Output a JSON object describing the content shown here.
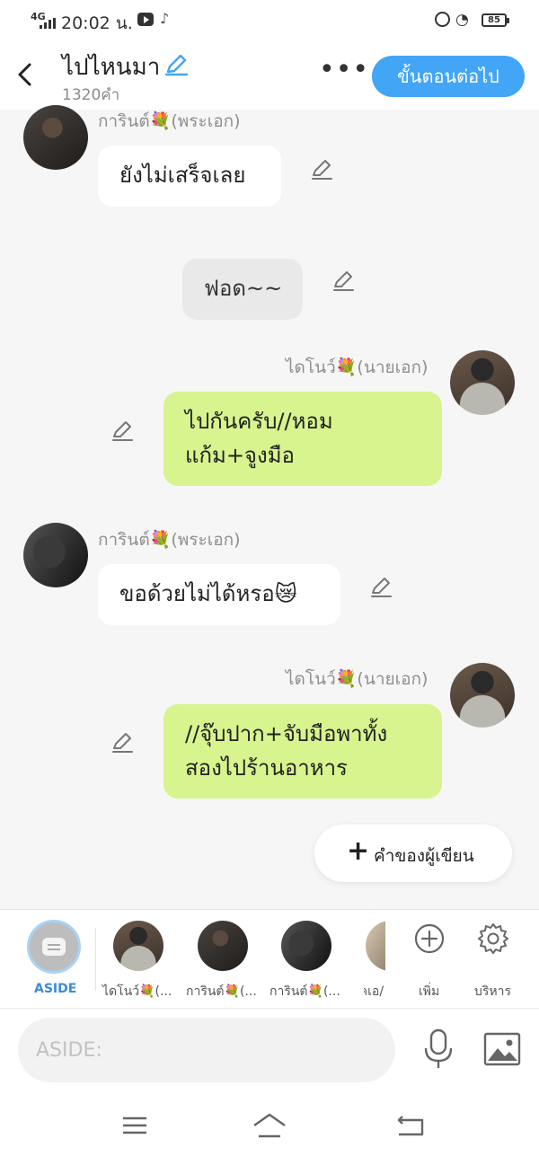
{
  "status_bar": {
    "network": "4G",
    "time": "20:02 น.",
    "battery": "85"
  },
  "header": {
    "title": "ไปไหนมา",
    "word_count": "1320คำ",
    "next_button": "ขั้นตอนต่อไป"
  },
  "messages": [
    {
      "speaker": "การินต์💐(พระเอก)",
      "text": "ยังไม่เสร็จเลย",
      "side": "left"
    },
    {
      "speaker": "",
      "text": "ฟอด~~",
      "side": "center"
    },
    {
      "speaker": "ไดโนว์💐(นายเอก)",
      "text_lines": [
        "ไปกันครับ//หอม",
        "แก้ม+จูงมือ"
      ],
      "side": "right"
    },
    {
      "speaker": "การินต์💐(พระเอก)",
      "text": "ขอด้วยไม่ได้หรอ😿",
      "side": "left"
    },
    {
      "speaker": "ไดโนว์💐(นายเอก)",
      "text_lines": [
        "//จุ๊บปาก+จับมือพาทั้ง",
        "สองไปร้านอาหาร"
      ],
      "side": "right"
    }
  ],
  "add_writer_label": "คำของผู้เขียน",
  "character_bar": {
    "aside_label": "ASIDE",
    "characters": [
      {
        "name": "ไดโนว์💐(..."
      },
      {
        "name": "การินต์💐(..."
      },
      {
        "name": "การินต์💐(..."
      },
      {
        "name": "เคเอ/"
      }
    ],
    "add_label": "เพิ่ม",
    "manage_label": "บริหาร"
  },
  "input": {
    "placeholder": "ASIDE:"
  },
  "colors": {
    "accent": "#42a5f5",
    "green_bubble": "#d8f48e"
  }
}
